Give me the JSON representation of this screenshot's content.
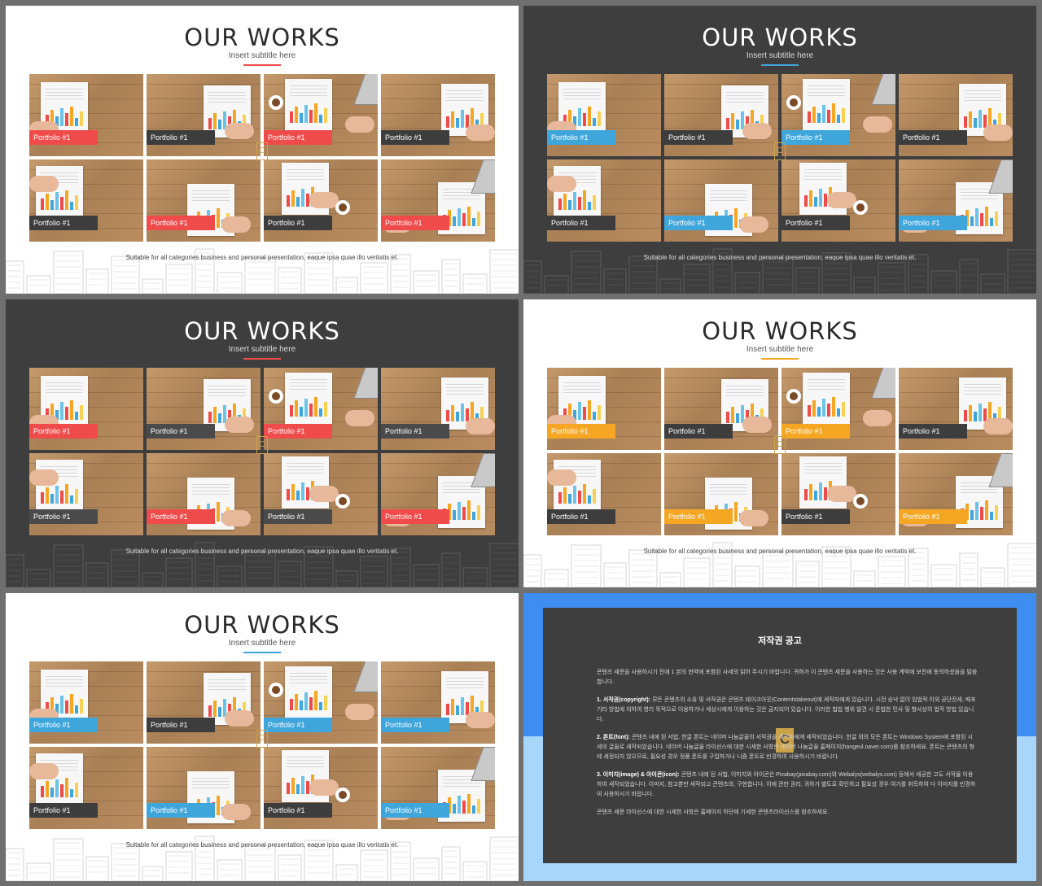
{
  "slides": [
    {
      "title": "OUR WORKS",
      "subtitle": "Insert subtitle here",
      "caption": "Suitable for all categories business and personal presentation, eaque ipsa quae illo veritatis et.",
      "theme": "light",
      "accent": "#ef4b4b",
      "dark_label": "#3d3d3d",
      "labels": [
        "Portfolio   #1",
        "Portfolio   #1",
        "Portfolio   #1",
        "Portfolio   #1",
        "Portfolio   #1",
        "Portfolio   #1",
        "Portfolio   #1",
        "Portfolio   #1"
      ],
      "accent_pattern": [
        true,
        false,
        true,
        false,
        false,
        true,
        false,
        true
      ]
    },
    {
      "title": "OUR WORKS",
      "subtitle": "Insert subtitle here",
      "caption": "Suitable for all categories business and personal presentation, eaque ipsa quae illo veritatis et.",
      "theme": "dark",
      "accent": "#3fa6dc",
      "dark_label": "#3d3d3d",
      "labels": [
        "Portfolio   #1",
        "Portfolio   #1",
        "Portfolio   #1",
        "Portfolio   #1",
        "Portfolio   #1",
        "Portfolio   #1",
        "Portfolio   #1",
        "Portfolio   #1"
      ],
      "accent_pattern": [
        true,
        false,
        true,
        false,
        false,
        true,
        false,
        true
      ]
    },
    {
      "title": "OUR WORKS",
      "subtitle": "Insert subtitle here",
      "caption": "Suitable for all categories business and personal presentation, eaque ipsa quae illo veritatis et.",
      "theme": "dark",
      "accent": "#ef4b4b",
      "dark_label": "#4a4a4a",
      "labels": [
        "Portfolio   #1",
        "Portfolio   #1",
        "Portfolio   #1",
        "Portfolio   #1",
        "Portfolio   #1",
        "Portfolio   #1",
        "Portfolio   #1",
        "Portfolio   #1"
      ],
      "accent_pattern": [
        true,
        false,
        true,
        false,
        false,
        true,
        false,
        true
      ]
    },
    {
      "title": "OUR WORKS",
      "subtitle": "Insert subtitle here",
      "caption": "Suitable for all categories business and personal presentation, eaque ipsa quae illo veritatis et.",
      "theme": "light",
      "accent": "#f5a623",
      "dark_label": "#3d3d3d",
      "labels": [
        "Portfolio   #1",
        "Portfolio   #1",
        "Portfolio   #1",
        "Portfolio   #1",
        "Portfolio   #1",
        "Portfolio   #1",
        "Portfolio   #1",
        "Portfolio   #1"
      ],
      "accent_pattern": [
        true,
        false,
        true,
        false,
        false,
        true,
        false,
        true
      ]
    },
    {
      "title": "OUR WORKS",
      "subtitle": "Insert subtitle here",
      "caption": "Suitable for all categories business and personal presentation, eaque ipsa quae illo veritatis et.",
      "theme": "light",
      "accent": "#3fa6dc",
      "dark_label": "#3d3d3d",
      "labels": [
        "Portfolio   #1",
        "Portfolio   #1",
        "Portfolio   #1",
        "Portfolio   #1",
        "Portfolio   #1",
        "Portfolio   #1",
        "Portfolio   #1",
        "Portfolio   #1"
      ],
      "accent_pattern": [
        true,
        false,
        true,
        true,
        false,
        true,
        false,
        true
      ]
    }
  ],
  "notice": {
    "title": "저작권 공고",
    "logo_letter": "C",
    "intro": "콘텐츠 세문을 사용하시기 전에 1 본의 현약에 포함된 사세의 읽어 주시기 바랍니다. 귀하가 이 콘텐츠 세문을 사용하는 것은 사용 계약에 보전에 동의하셨음을 말씀합니다.",
    "p1_head": "1. 서작권(copyright):",
    "p1": " 모든 콘텐츠의 소유 및 서작권은 콘텐츠 테이크아웃(Contentstakeout)에 세작자에게 있습니다. 시전 승낙 없이 임법적 이외 공단전세, 배포 기타 방법에 의하여 영리 목적으로 이용하거나 세상시에게 이용하는 것은 금지되어 있습니다. 이러한 법법 행위 발견 시 준법한 민사 및 형사상의 법적 방법 있습니다.",
    "p2_head": "2. 폰트(font):",
    "p2": " 콘텐츠 내에 된 서법, 한글 폰트는 네이버 나눔글꼴의 서작권을 세작자에게 세작되었습니다. 한글 외의 모든 폰트는 Windows System에 포함된 시세의 글꼴로 세작되었습니다. 네이버 나눔글꼴 라이선스에 대한 시세한 사항은 네이버 나눔글꼴 홈페이지(hangeul.naver.com)를 참조하세요. 폰트는 콘텐츠의 형에 세정되지 않으므로, 필요성 경우 정품 폰트를 구입하거나 니즘 폰트로 빈경하여 사용하시기 바랍니다.",
    "p3_head": "3. 이미지(image) & 아이콘(icon):",
    "p3": " 콘텐츠 내에 된 서법, 이미지와 아이콘은 Pixabay(pixabay.com)와 Webalys(webalys.com) 등에서 세공한 고도 서작물 이용하여 세작되었습니다. 이미지, 참고뿐만 세작되고 콘텐츠의, 구현합니다. 이에 관한 권리, 귀하가 별도로 확인하고 필요성 경우 여기를 취득하여 다 이미지를 빈경하여 사용하시기 바랍니다.",
    "outro": "콘텐츠 세문 라이선스에 대한 시세한 사항은 홈페이지 하단에 기세한 콘텐츠라이선스를 참조하세요."
  }
}
